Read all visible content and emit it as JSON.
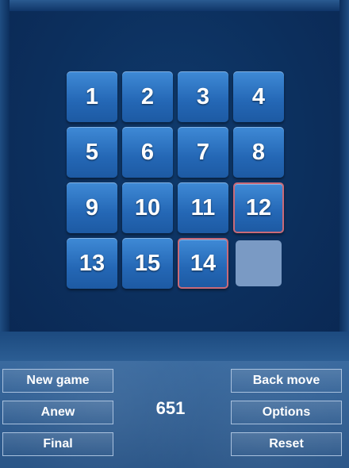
{
  "board": {
    "tiles": [
      {
        "label": "1",
        "misplaced": false
      },
      {
        "label": "2",
        "misplaced": false
      },
      {
        "label": "3",
        "misplaced": false
      },
      {
        "label": "4",
        "misplaced": false
      },
      {
        "label": "5",
        "misplaced": false
      },
      {
        "label": "6",
        "misplaced": false
      },
      {
        "label": "7",
        "misplaced": false
      },
      {
        "label": "8",
        "misplaced": false
      },
      {
        "label": "9",
        "misplaced": false
      },
      {
        "label": "10",
        "misplaced": false
      },
      {
        "label": "11",
        "misplaced": false
      },
      {
        "label": "12",
        "misplaced": true
      },
      {
        "label": "13",
        "misplaced": false
      },
      {
        "label": "15",
        "misplaced": false
      },
      {
        "label": "14",
        "misplaced": true
      },
      {
        "label": "",
        "empty": true
      }
    ],
    "colors": {
      "tile": "#2a70c0",
      "misplaced_border": "#c96a78",
      "empty_cell": "#7a9ac4",
      "background": "#0c2d57"
    }
  },
  "controls": {
    "new_game": "New game",
    "anew": "Anew",
    "final": "Final",
    "back_move": "Back move",
    "options": "Options",
    "reset": "Reset"
  },
  "status": {
    "move_count": "651"
  }
}
